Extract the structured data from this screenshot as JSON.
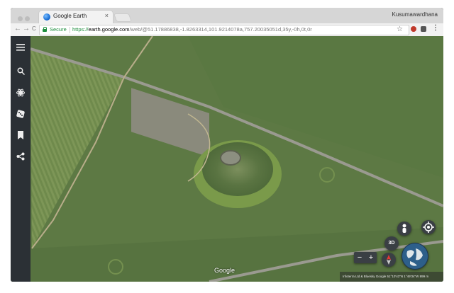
{
  "browser": {
    "tab_title": "Google Earth",
    "tab_close": "×",
    "profile_name": "Kusumawardhana",
    "secure_label": "Secure",
    "url_proto": "https://",
    "url_host": "earth.google.com",
    "url_path": "/web/@51.17886838,-1.8263314,101.9214078a,757.20035051d,35y,-0h,0t,0r",
    "nav_back": "←",
    "nav_forward": "→",
    "nav_reload": "C",
    "bookmark_star": "☆",
    "menu_dots": "⋮"
  },
  "sidebar": {
    "items": [
      {
        "name": "menu-icon",
        "glyph": "≡"
      },
      {
        "name": "search-icon",
        "glyph": ""
      },
      {
        "name": "voyager-icon",
        "glyph": "✲"
      },
      {
        "name": "feeling-lucky-icon",
        "glyph": ""
      },
      {
        "name": "projects-bookmark-icon",
        "glyph": ""
      },
      {
        "name": "share-icon",
        "glyph": ""
      }
    ]
  },
  "controls": {
    "view_3d_label": "3D",
    "zoom_out": "−",
    "zoom_in": "+"
  },
  "map": {
    "google_watermark": "Google",
    "attribution": "Infoterra Ltd & Bluesky   Google    51°10'43\"N 1°49'34\"W   899 m"
  },
  "colors": {
    "sidebar_bg": "#2b3035",
    "secure_green": "#1e8e3e",
    "grass_base": "#5f7a45"
  }
}
